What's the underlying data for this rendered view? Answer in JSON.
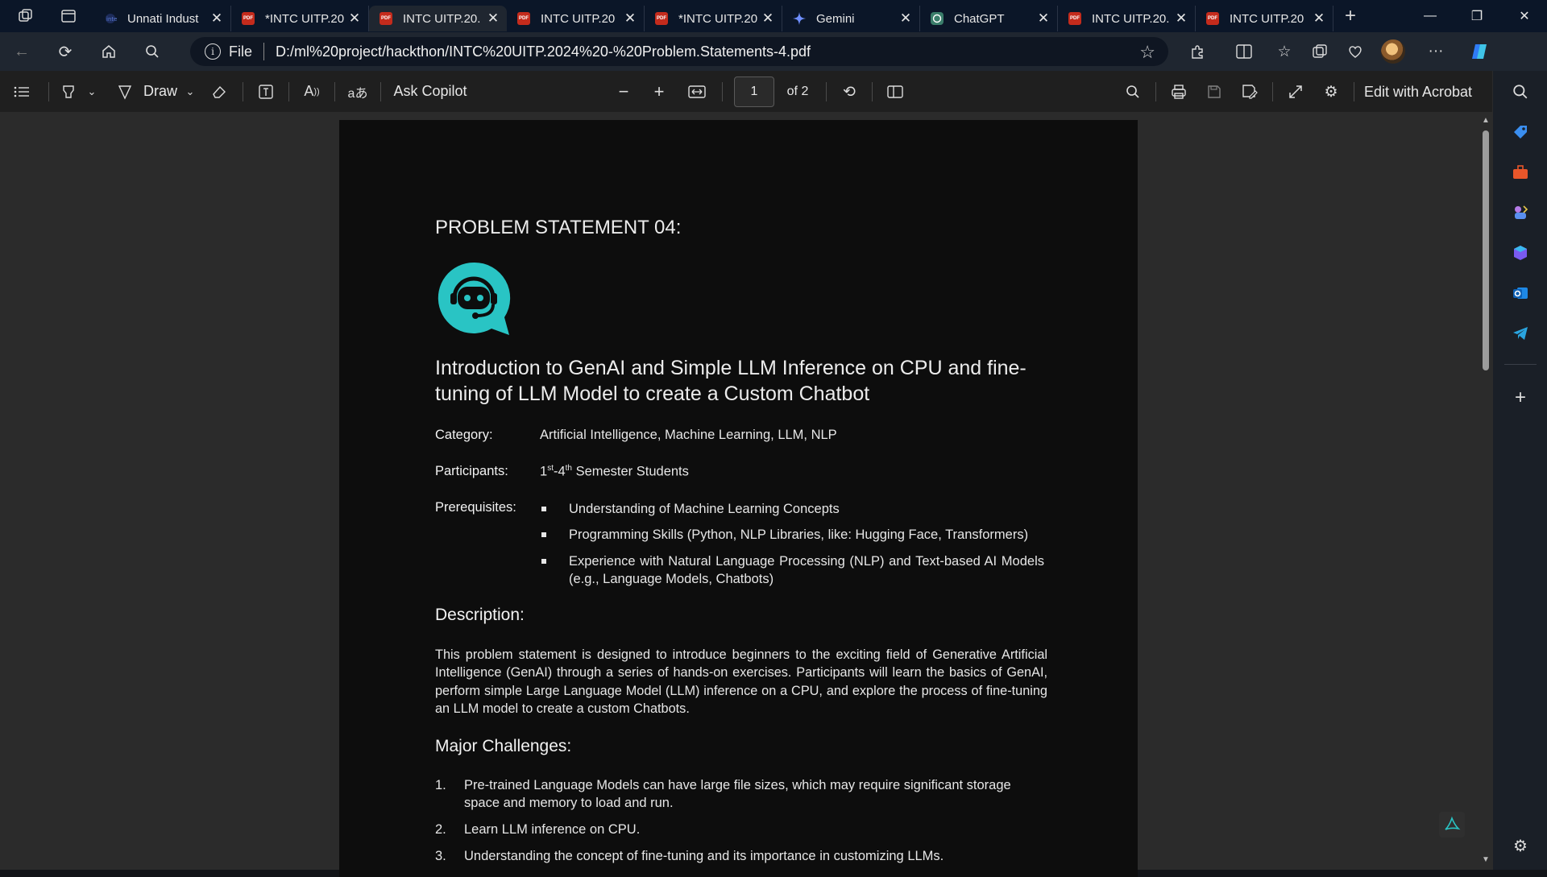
{
  "tabs": [
    {
      "label": "Unnati Indust",
      "icon": "site-icon",
      "active": false
    },
    {
      "label": "*INTC UITP.20",
      "icon": "pdf-icon",
      "active": false
    },
    {
      "label": "INTC UITP.20.",
      "icon": "pdf-icon",
      "active": true
    },
    {
      "label": "INTC UITP.20",
      "icon": "pdf-icon",
      "active": false
    },
    {
      "label": "*INTC UITP.20",
      "icon": "pdf-icon",
      "active": false
    },
    {
      "label": "Gemini",
      "icon": "gemini-icon",
      "active": false
    },
    {
      "label": "ChatGPT",
      "icon": "chatgpt-icon",
      "active": false
    },
    {
      "label": "INTC UITP.20.",
      "icon": "pdf-icon",
      "active": false
    },
    {
      "label": "INTC UITP.20",
      "icon": "pdf-icon",
      "active": false
    }
  ],
  "address": {
    "scheme_label": "File",
    "url": "D:/ml%20project/hackthon/INTC%20UITP.2024%20-%20Problem.Statements-4.pdf"
  },
  "pdf_toolbar": {
    "draw_label": "Draw",
    "ask_copilot_label": "Ask Copilot",
    "page_current": "1",
    "page_total": "of 2",
    "edit_with_acrobat_label": "Edit with Acrobat"
  },
  "document": {
    "heading": "PROBLEM STATEMENT 04:",
    "title": "Introduction to GenAI and Simple LLM Inference on CPU and fine-tuning of LLM Model to create a Custom Chatbot",
    "category_label": "Category:",
    "category_value": "Artificial Intelligence, Machine Learning, LLM, NLP",
    "participants_label": "Participants:",
    "participants_value_pre": "1",
    "participants_sup1": "st",
    "participants_mid": "-4",
    "participants_sup2": "th",
    "participants_post": " Semester Students",
    "prerequisites_label": "Prerequisites:",
    "prerequisites": [
      "Understanding of Machine Learning Concepts",
      "Programming Skills (Python, NLP Libraries, like: Hugging Face, Transformers)",
      "Experience with Natural Language Processing (NLP) and Text-based AI Models (e.g., Language Models, Chatbots)"
    ],
    "description_heading": "Description:",
    "description": "This problem statement is designed to introduce beginners to the exciting field of Generative Artificial Intelligence (GenAI) through a series of hands-on exercises. Participants will learn the basics of GenAI, perform simple Large Language Model (LLM) inference on a CPU, and explore the process of fine-tuning an LLM model to create a custom Chatbots.",
    "challenges_heading": "Major Challenges:",
    "challenges": [
      {
        "num": "1.",
        "text": "Pre-trained Language Models can have large file sizes, which may require significant storage space and memory to load and run."
      },
      {
        "num": "2.",
        "text": "Learn LLM inference on CPU."
      },
      {
        "num": "3.",
        "text": "Understanding the concept of fine-tuning and its importance in customizing LLMs."
      }
    ]
  },
  "colors": {
    "accent_teal": "#29c4c4",
    "pdf_red": "#c42b1c"
  }
}
